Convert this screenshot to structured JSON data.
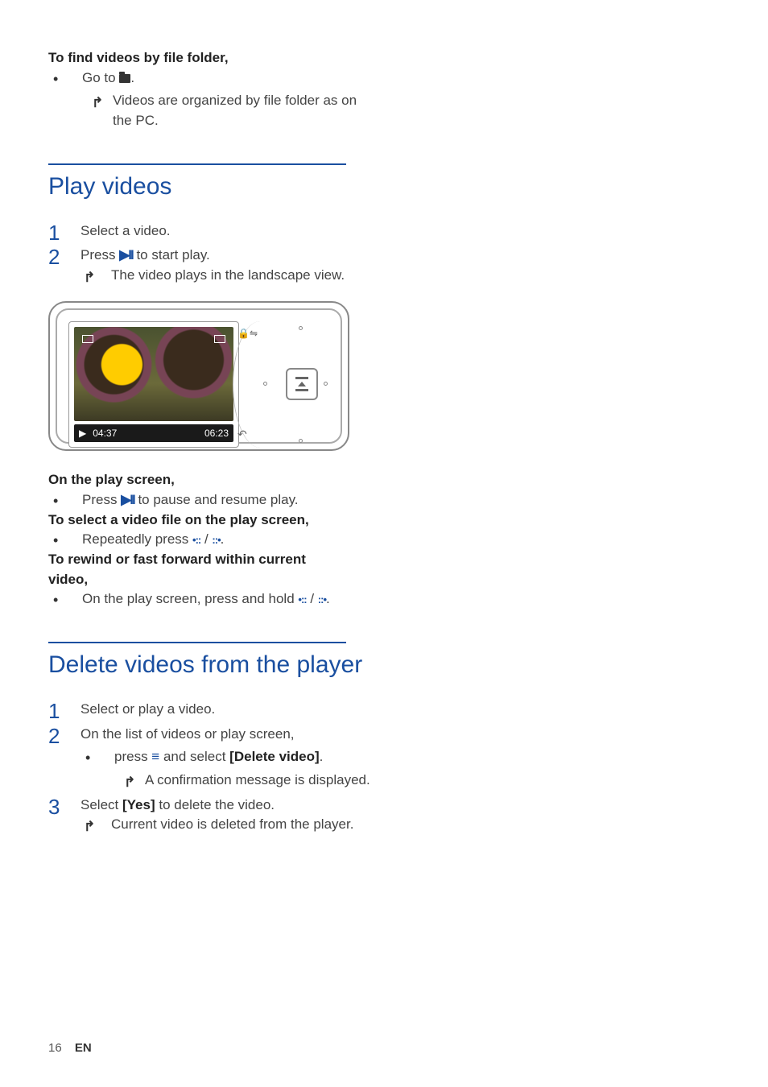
{
  "intro": {
    "title": "To find videos by file folder,",
    "bullet_prefix": "Go to ",
    "bullet_suffix": ".",
    "result": "Videos are organized by file folder as on the PC."
  },
  "play": {
    "heading": "Play videos",
    "steps": [
      {
        "n": "1",
        "text": "Select a video."
      },
      {
        "n": "2",
        "pre": "Press ",
        "post": " to start play.",
        "result": "The video plays in the landscape view."
      }
    ],
    "device": {
      "t1": "04:37",
      "t2": "06:23"
    },
    "below1": "On the play screen,",
    "below1_bullet_pre": "Press ",
    "below1_bullet_post": " to pause and resume play.",
    "below2": "To select a video file on the play screen,",
    "below2_bullet_pre": "Repeatedly press ",
    "below2_bullet_mid": " / ",
    "below2_bullet_post": ".",
    "below3a": "To rewind or fast forward within current",
    "below3b": "video,",
    "below3_bullet_pre": "On the play screen, press and hold ",
    "below3_bullet_mid": " / ",
    "below3_bullet_post": "."
  },
  "delete": {
    "heading": "Delete videos from the player",
    "steps": [
      {
        "n": "1",
        "text": "Select or play a video."
      },
      {
        "n": "2",
        "text": "On the list of videos or play screen,",
        "sub_pre": "press ",
        "sub_mid": " and select ",
        "sub_bold": "[Delete video]",
        "sub_post": ".",
        "result": "A confirmation message is displayed."
      },
      {
        "n": "3",
        "pre": "Select ",
        "bold": "[Yes]",
        "post": " to delete the video.",
        "result": "Current video is deleted from the player."
      }
    ]
  },
  "footer": {
    "page": "16",
    "lang": "EN"
  }
}
